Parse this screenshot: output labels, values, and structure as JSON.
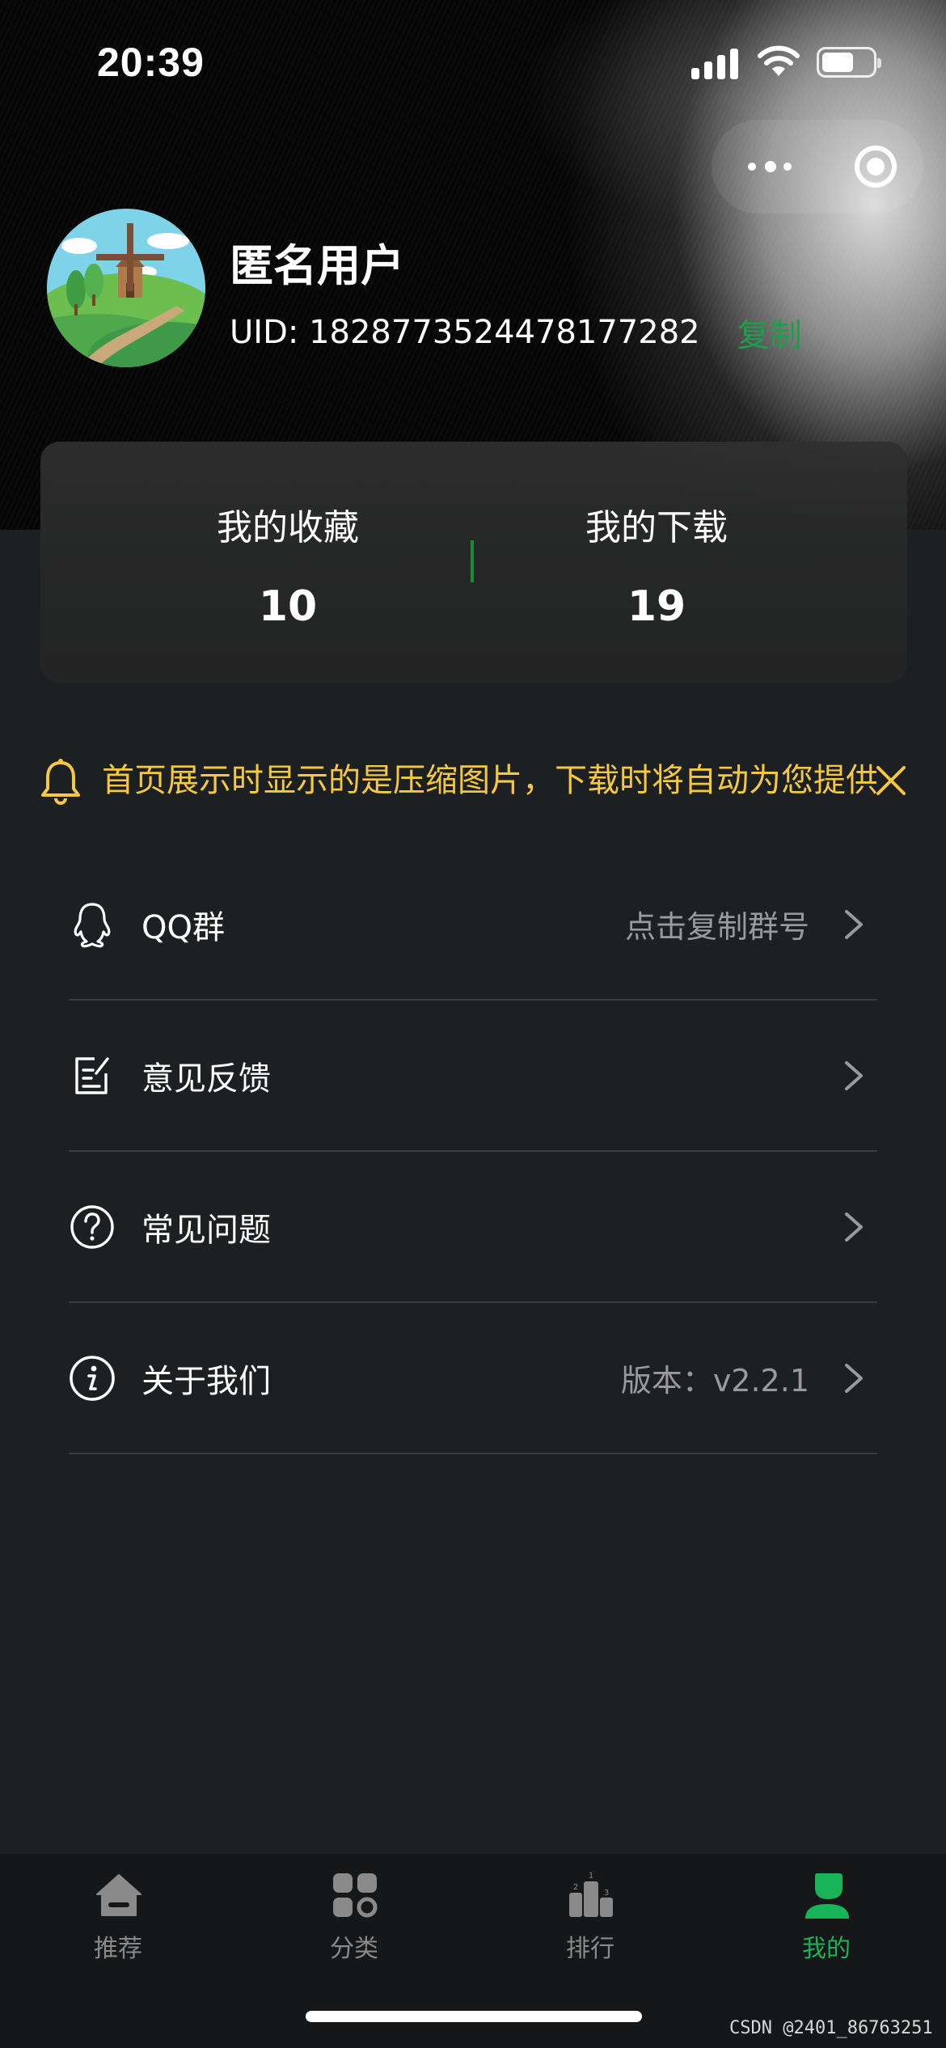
{
  "status_bar": {
    "time": "20:39"
  },
  "profile": {
    "username": "匿名用户",
    "uid": "UID: 1828773524478177282",
    "copy_label": "复制"
  },
  "stats": {
    "favorites": {
      "label": "我的收藏",
      "value": "10"
    },
    "downloads": {
      "label": "我的下载",
      "value": "19"
    }
  },
  "notice": {
    "text": "首页展示时显示的是压缩图片，下载时将自动为您提供"
  },
  "menu": [
    {
      "label": "QQ群",
      "value": "点击复制群号",
      "icon": "qq-icon"
    },
    {
      "label": "意见反馈",
      "value": "",
      "icon": "feedback-icon"
    },
    {
      "label": "常见问题",
      "value": "",
      "icon": "question-icon"
    },
    {
      "label": "关于我们",
      "value": "版本：v2.2.1",
      "icon": "info-icon"
    }
  ],
  "tabbar": [
    {
      "label": "推荐",
      "icon": "home-icon",
      "active": false
    },
    {
      "label": "分类",
      "icon": "category-icon",
      "active": false
    },
    {
      "label": "排行",
      "icon": "podium-icon",
      "active": false
    },
    {
      "label": "我的",
      "icon": "user-icon",
      "active": true
    }
  ],
  "colors": {
    "accent_green": "#19b35a",
    "notice_yellow": "#f5c842",
    "background": "#1c2022"
  },
  "watermark": "CSDN @2401_86763251"
}
